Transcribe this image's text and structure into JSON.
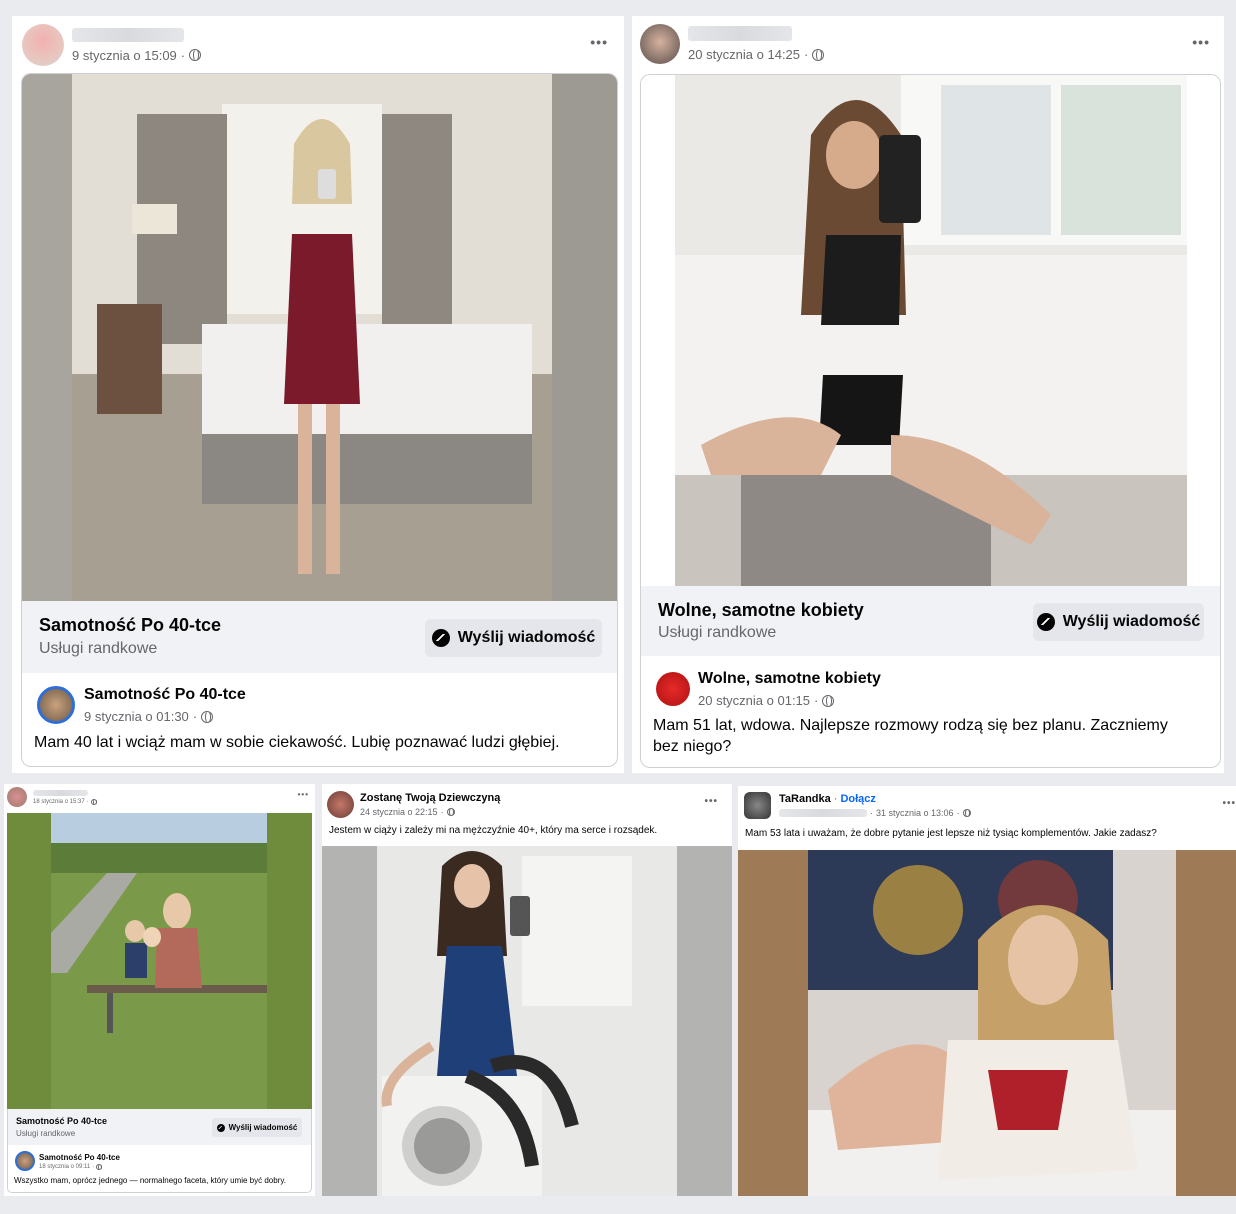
{
  "posts": [
    {
      "time": "9 stycznia o 15:09",
      "ad_title": "Samotność Po 40-tce",
      "ad_subtitle": "Usługi randkowe",
      "button": "Wyślij wiadomość",
      "page_name": "Samotność Po 40-tce",
      "page_time": "9 stycznia o 01:30",
      "text": "Mam 40 lat i wciąż mam w sobie ciekawość. Lubię poznawać ludzi głębiej."
    },
    {
      "time": "20 stycznia o 14:25",
      "ad_title": "Wolne, samotne kobiety",
      "ad_subtitle": "Usługi randkowe",
      "button": "Wyślij wiadomość",
      "page_name": "Wolne, samotne kobiety",
      "page_time": "20 stycznia o 01:15",
      "text": "Mam 51 lat, wdowa. Najlepsze rozmowy rodzą się bez planu. Zaczniemy bez niego?"
    },
    {
      "time": "18 stycznia o 15:37",
      "ad_title": "Samotność Po 40-tce",
      "ad_subtitle": "Usługi randkowe",
      "button": "Wyślij wiadomość",
      "page_name": "Samotność Po 40-tce",
      "page_time": "18 stycznia o 09:11",
      "text": "Wszystko mam, oprócz jednego — normalnego faceta, który umie być dobry."
    },
    {
      "author": "Zostanę Twoją Dziewczyną",
      "time": "24 stycznia o 22:15",
      "text": "Jestem w ciąży i zależy mi na mężczyźnie 40+, który ma serce i rozsądek."
    },
    {
      "author": "TaRandka",
      "join": "Dołącz",
      "time": "31 stycznia o 13:06",
      "text": "Mam 53 lata i uważam, że dobre pytanie jest lepsze niż tysiąc komplementów. Jakie zadasz?"
    }
  ],
  "more_label": "•••",
  "colors": {
    "link": "#0866ff",
    "secondary": "#65676b",
    "adbar": "#f0f2f5"
  }
}
